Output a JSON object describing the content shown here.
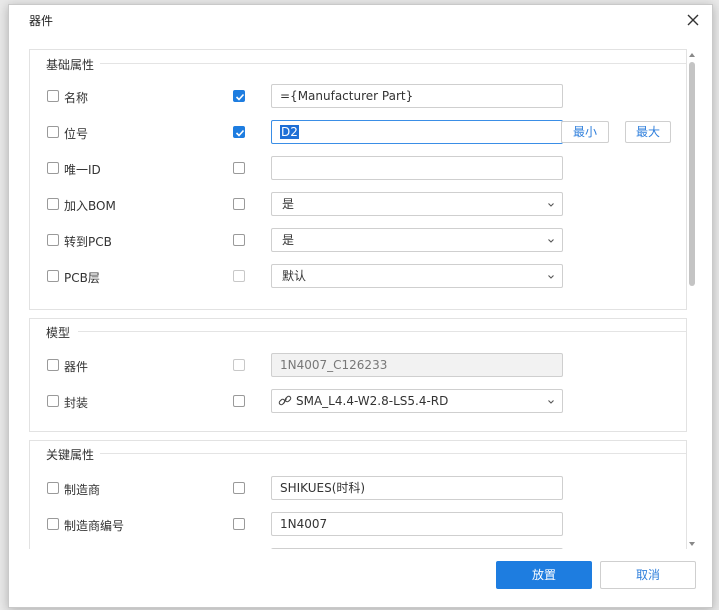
{
  "dialog": {
    "title": "器件",
    "close_label": "close"
  },
  "basic": {
    "title": "基础属性",
    "rows": [
      {
        "label": "名称",
        "checked": true,
        "value": "={Manufacturer Part}",
        "type": "text"
      },
      {
        "label": "位号",
        "checked": true,
        "value": "D2",
        "type": "text-selected"
      },
      {
        "label": "唯一ID",
        "checked": false,
        "value": "",
        "type": "text"
      },
      {
        "label": "加入BOM",
        "checked": false,
        "value": "是",
        "type": "select"
      },
      {
        "label": "转到PCB",
        "checked": false,
        "value": "是",
        "type": "select"
      },
      {
        "label": "PCB层",
        "checked": false,
        "value": "默认",
        "type": "select-disabled-check"
      }
    ],
    "min_label": "最小",
    "max_label": "最大"
  },
  "model": {
    "title": "模型",
    "rows": [
      {
        "label": "器件",
        "checked": false,
        "value": "1N4007_C126233",
        "type": "text-disabled"
      },
      {
        "label": "封装",
        "checked": false,
        "value": "SMA_L4.4-W2.8-LS5.4-RD",
        "type": "select-link"
      }
    ]
  },
  "key": {
    "title": "关键属性",
    "rows": [
      {
        "label": "制造商",
        "checked": false,
        "value": "SHIKUES(时科)",
        "type": "text"
      },
      {
        "label": "制造商编号",
        "checked": false,
        "value": "1N4007",
        "type": "text"
      }
    ]
  },
  "footer": {
    "ok_label": "放置",
    "cancel_label": "取消"
  },
  "colors": {
    "accent": "#1e7de0",
    "link": "#2f7fdc",
    "border": "#cfcfcf"
  }
}
